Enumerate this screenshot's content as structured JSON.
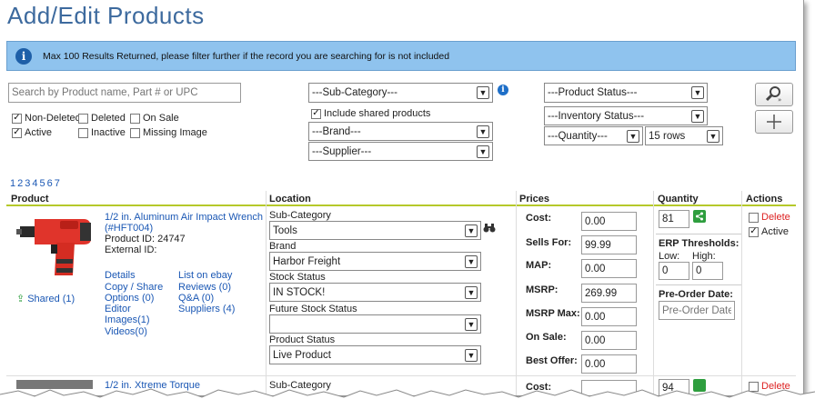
{
  "page": {
    "title": "Add/Edit Products"
  },
  "notice": {
    "text": "Max 100 Results Returned, please filter further if the record you are searching for is not included"
  },
  "filters": {
    "search_placeholder": "Search by Product name, Part # or UPC",
    "subcategory": "---Sub-Category---",
    "include_shared": "Include shared products",
    "brand": "---Brand---",
    "supplier": "---Supplier---",
    "product_status": "---Product Status---",
    "inventory_status": "---Inventory Status---",
    "quantity": "---Quantity---",
    "rows": "15 rows",
    "checks": {
      "non_deleted": "Non-Deleted",
      "deleted": "Deleted",
      "on_sale": "On Sale",
      "active": "Active",
      "inactive": "Inactive",
      "missing_image": "Missing Image"
    }
  },
  "pager": [
    "1",
    "2",
    "3",
    "4",
    "5",
    "6",
    "7"
  ],
  "columns": {
    "product": "Product",
    "location": "Location",
    "prices": "Prices",
    "quantity": "Quantity",
    "actions": "Actions"
  },
  "row1": {
    "name_line1": "1/2 in. Aluminum Air Impact Wrench",
    "name_line2": "(#HFT004)",
    "product_id": "Product ID: 24747",
    "external_id": "External ID:",
    "shared": "Shared (1)",
    "links_left": [
      "Details",
      "Copy / Share",
      "Options (0)",
      "Editor",
      "Images(1)",
      "Videos(0)"
    ],
    "links_right": [
      "List on ebay",
      "Reviews (0)",
      "Q&A (0)",
      "Suppliers (4)"
    ],
    "location": {
      "subcategory_label": "Sub-Category",
      "subcategory_value": "Tools",
      "brand_label": "Brand",
      "brand_value": "Harbor Freight",
      "stock_label": "Stock Status",
      "stock_value": "IN STOCK!",
      "future_label": "Future Stock Status",
      "future_value": "",
      "pstatus_label": "Product Status",
      "pstatus_value": "Live Product"
    },
    "prices": {
      "cost_label": "Cost:",
      "cost": "0.00",
      "sells_label": "Sells For:",
      "sells": "99.99",
      "map_label": "MAP:",
      "map": "0.00",
      "msrp_label": "MSRP:",
      "msrp": "269.99",
      "msrpmax_label": "MSRP Max:",
      "msrpmax": "0.00",
      "onsale_label": "On Sale:",
      "onsale": "0.00",
      "bestoffer_label": "Best Offer:",
      "bestoffer": "0.00"
    },
    "quantity": {
      "value": "81",
      "erp_label": "ERP Thresholds:",
      "low_label": "Low:",
      "low": "0",
      "high_label": "High:",
      "high": "0",
      "preorder_label": "Pre-Order Date:",
      "preorder_placeholder": "Pre-Order Date."
    },
    "actions": {
      "delete": "Delete",
      "active": "Active"
    }
  },
  "row2": {
    "name_partial": "1/2 in. Xtreme Torque",
    "subcategory_label": "Sub-Category",
    "cost_label": "Cost:",
    "quantity": "94",
    "delete": "Delete"
  }
}
